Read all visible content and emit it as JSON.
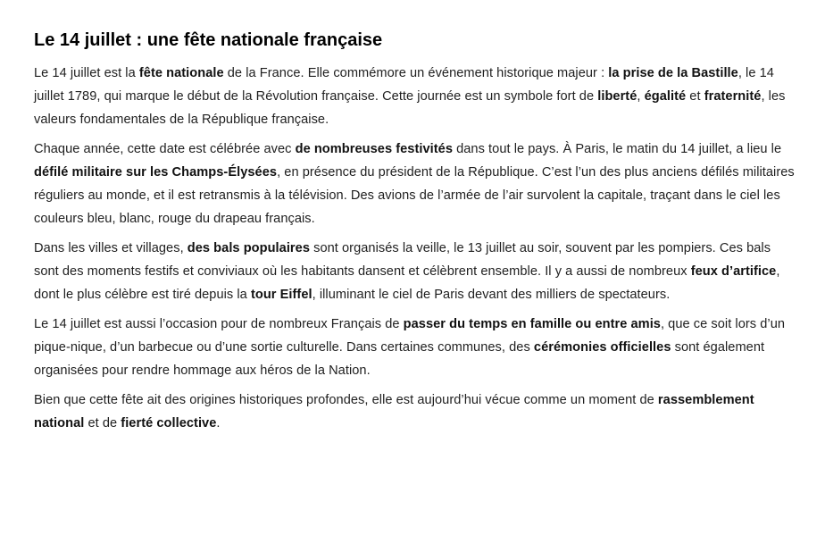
{
  "article": {
    "title": "Le 14 juillet : une fête nationale française",
    "paragraphs": [
      [
        {
          "t": "Le 14 juillet est la ",
          "b": false
        },
        {
          "t": "fête nationale",
          "b": true
        },
        {
          "t": " de la France. Elle commémore un événement historique majeur : ",
          "b": false
        },
        {
          "t": "la prise de la Bastille",
          "b": true
        },
        {
          "t": ", le 14 juillet 1789, qui marque le début de la Révolution française. Cette journée est un symbole fort de ",
          "b": false
        },
        {
          "t": "liberté",
          "b": true
        },
        {
          "t": ", ",
          "b": false
        },
        {
          "t": "égalité",
          "b": true
        },
        {
          "t": " et ",
          "b": false
        },
        {
          "t": "fraternité",
          "b": true
        },
        {
          "t": ", les valeurs fondamentales de la République française.",
          "b": false
        }
      ],
      [
        {
          "t": "Chaque année, cette date est célébrée avec ",
          "b": false
        },
        {
          "t": "de nombreuses festivités",
          "b": true
        },
        {
          "t": " dans tout le pays. À Paris, le matin du 14 juillet, a lieu le ",
          "b": false
        },
        {
          "t": "défilé militaire sur les Champs-Élysées",
          "b": true
        },
        {
          "t": ", en présence du président de la République. C’est l’un des plus anciens défilés militaires réguliers au monde, et il est retransmis à la télévision. Des avions de l’armée de l’air survolent la capitale, traçant dans le ciel les couleurs bleu, blanc, rouge du drapeau français.",
          "b": false
        }
      ],
      [
        {
          "t": "Dans les villes et villages, ",
          "b": false
        },
        {
          "t": "des bals populaires",
          "b": true
        },
        {
          "t": " sont organisés la veille, le 13 juillet au soir, souvent par les pompiers. Ces bals sont des moments festifs et conviviaux où les habitants dansent et célèbrent ensemble. Il y a aussi de nombreux ",
          "b": false
        },
        {
          "t": "feux d’artifice",
          "b": true
        },
        {
          "t": ", dont le plus célèbre est tiré depuis la ",
          "b": false
        },
        {
          "t": "tour Eiffel",
          "b": true
        },
        {
          "t": ", illuminant le ciel de Paris devant des milliers de spectateurs.",
          "b": false
        }
      ],
      [
        {
          "t": "Le 14 juillet est aussi l’occasion pour de nombreux Français de ",
          "b": false
        },
        {
          "t": "passer du temps en famille ou entre amis",
          "b": true
        },
        {
          "t": ", que ce soit lors d’un pique-nique, d’un barbecue ou d’une sortie culturelle. Dans certaines communes, des ",
          "b": false
        },
        {
          "t": "cérémonies officielles",
          "b": true
        },
        {
          "t": " sont également organisées pour rendre hommage aux héros de la Nation.",
          "b": false
        }
      ],
      [
        {
          "t": "Bien que cette fête ait des origines historiques profondes, elle est aujourd’hui vécue comme un moment de ",
          "b": false
        },
        {
          "t": "rassemblement national",
          "b": true
        },
        {
          "t": " et de ",
          "b": false
        },
        {
          "t": "fierté collective",
          "b": true
        },
        {
          "t": ".",
          "b": false
        }
      ]
    ]
  }
}
